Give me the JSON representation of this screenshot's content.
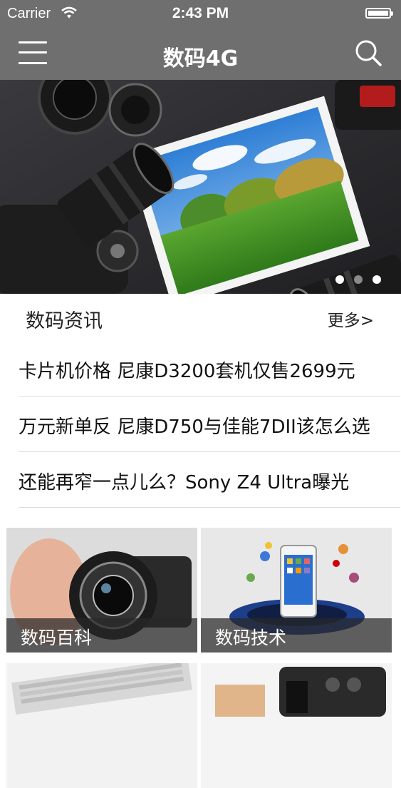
{
  "status_bar": {
    "carrier": "Carrier",
    "time": "2:43 PM"
  },
  "nav": {
    "title": "数码4G",
    "menu_icon": "hamburger-menu-icon",
    "search_icon": "search-icon"
  },
  "banner": {
    "slides": 3,
    "active_slide": 3
  },
  "news": {
    "section_title": "数码资讯",
    "more_label": "更多>",
    "items": [
      {
        "title": "卡片机价格 尼康D3200套机仅售2699元"
      },
      {
        "title": "万元新单反 尼康D750与佳能7DII该怎么选"
      },
      {
        "title": "还能再窄一点儿么？Sony Z4 Ultra曝光"
      }
    ]
  },
  "tiles": [
    {
      "label": "数码百科"
    },
    {
      "label": "数码技术"
    },
    {
      "label": ""
    },
    {
      "label": ""
    }
  ],
  "colors": {
    "nav_bg": "#6f6f6f",
    "divider": "#dcdcdc",
    "text": "#111111"
  }
}
